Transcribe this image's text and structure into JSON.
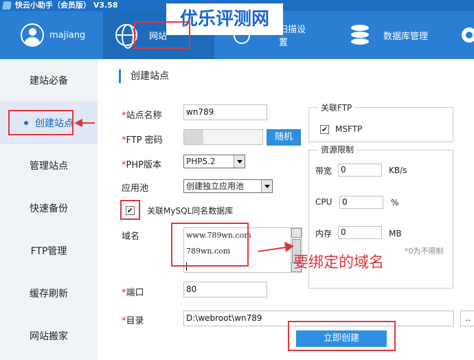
{
  "window": {
    "title": "快云小助手（会员版） V3.58"
  },
  "watermark": "优乐评测网",
  "topnav": {
    "user": "majiang",
    "items": [
      {
        "label": "网站"
      },
      {
        "label": "扫描设置"
      },
      {
        "label": "数据库管理"
      }
    ]
  },
  "sidebar": {
    "items": [
      {
        "label": "建站必备"
      },
      {
        "label": "创建站点"
      },
      {
        "label": "管理站点"
      },
      {
        "label": "快速备份"
      },
      {
        "label": "FTP管理"
      },
      {
        "label": "缓存刷新"
      },
      {
        "label": "网站搬家"
      }
    ],
    "active": 1
  },
  "form": {
    "section_title": "创建站点",
    "site_name_label": "站点名称",
    "site_name_value": "wn789",
    "ftp_password_label": "FTP 密码",
    "random_button": "随机",
    "php_label": "PHP版本",
    "php_value": "PHP5.2",
    "pool_label": "应用池",
    "pool_value": "创建独立应用池",
    "mysql_checkbox_label": "关联MySQL同名数据库",
    "mysql_checked": true,
    "domain_label": "域名",
    "domains": [
      "www.789wn.com",
      "789wn.com"
    ],
    "port_label": "端口",
    "port_value": "80",
    "dir_label": "目录",
    "dir_value": "D:\\webroot\\wn789",
    "browse_button": "..",
    "create_button": "立即创建",
    "required_mark": "*"
  },
  "ftp_group": {
    "title": "关联FTP",
    "checkbox_label": "MSFTP",
    "checked": true
  },
  "limits_group": {
    "title": "资源限制",
    "bandwidth_label": "带宽",
    "bandwidth_value": "0",
    "bandwidth_unit": "KB/s",
    "cpu_label": "CPU",
    "cpu_value": "0",
    "cpu_unit": "%",
    "memory_label": "内存",
    "memory_value": "0",
    "memory_unit": "MB",
    "hint": "*0为不限制"
  },
  "annotation": "要绑定的域名",
  "colors": {
    "accent": "#2a7fd4",
    "highlight": "#e3343a"
  }
}
